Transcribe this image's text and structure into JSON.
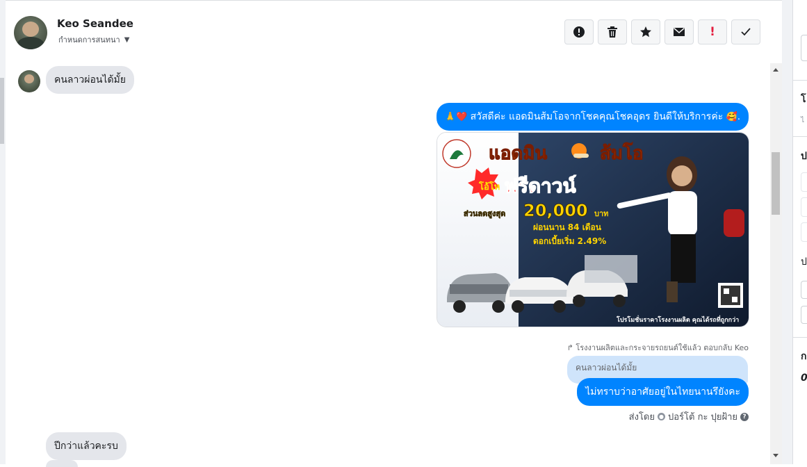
{
  "header": {
    "contact_name": "Keo Seandee",
    "assign_label": "กำหนดการสนทนา",
    "actions": [
      {
        "name": "report-spam-button",
        "icon": "exclamation-circle-icon"
      },
      {
        "name": "delete-button",
        "icon": "trash-icon"
      },
      {
        "name": "star-button",
        "icon": "star-icon"
      },
      {
        "name": "mark-unread-button",
        "icon": "envelope-icon"
      },
      {
        "name": "follow-up-button",
        "icon": "exclamation-icon"
      },
      {
        "name": "mark-done-button",
        "icon": "check-icon"
      }
    ]
  },
  "messages": {
    "incoming_1": "คนลาวผ่อนได้มั้ย",
    "outgoing_greeting": "สวัสดีค่ะ แอดมินส้มโอจากโชคคุณโชคอุดร ยินดีให้บริการค่ะ",
    "greeting_emoji_prefix": "🙏❤️",
    "greeting_emoji_suffix": "🥰.",
    "promo": {
      "title_part1": "แอดมิน",
      "title_part2": "ส้มโอ",
      "badge": "โอ้โห",
      "headline": "ฟรีดาวน์",
      "discount_label": "ส่วนลดสูงสุด",
      "discount_value": "20,000",
      "discount_unit": "บาท",
      "installment": "ผ่อนนาน 84 เดือน",
      "interest": "ดอกเบี้ยเริ่ม 2.49%",
      "footer": "โปรโมชั่นราคาโรงงานผลิต คุณได้รถที่ถูกกว่า"
    },
    "reply_meta": "โรงงานผลิตและกระจายรถยนต์ใช้แล้ว ตอบกลับ Keo",
    "quoted_text": "คนลาวผ่อนได้มั้ย",
    "outgoing_reply": "ไม่ทราบว่าอาศัยอยู่ในไทยนานรึยังคะ",
    "sent_by_label": "ส่งโดย",
    "sent_by_name": "ปอร์โต้ กะ ปุยฝ้าย",
    "incoming_2": "ปีกว่าแล้วคะรบ"
  },
  "right_panel": {
    "labels": [
      "โ",
      "ไ",
      "ป",
      "ป",
      "ก",
      "0"
    ]
  }
}
